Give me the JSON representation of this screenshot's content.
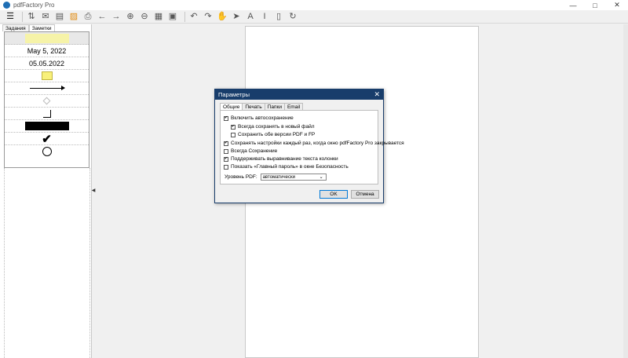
{
  "window": {
    "title": "pdfFactory Pro"
  },
  "toolbar": {
    "icons": [
      "menu-icon",
      "clip-icon",
      "email-icon",
      "save-icon",
      "open-folder-icon",
      "print-icon",
      "back-arrow-icon",
      "forward-arrow-icon",
      "zoom-in-icon",
      "zoom-out-icon",
      "grid-icon",
      "fit-page-icon",
      "undo-icon",
      "redo-icon",
      "hand-tool-icon",
      "pointer-icon",
      "text-tool-icon",
      "text-select-icon",
      "columns-icon",
      "refresh-icon"
    ]
  },
  "left_panel": {
    "tabs": [
      "Задания",
      "Заметки"
    ],
    "date_long": "May 5, 2022",
    "date_short": "05.05.2022"
  },
  "dialog": {
    "title": "Параметры",
    "tabs": [
      "Общие",
      "Печать",
      "Папки",
      "Email"
    ],
    "options": [
      {
        "label": "Включить автосохранение",
        "checked": true
      },
      {
        "label": "Всегда сохранять в новый файл",
        "checked": true
      },
      {
        "label": "Сохранить обе версии PDF и FP",
        "checked": false
      },
      {
        "label": "Сохранять настройки каждый раз, когда окно pdfFactory Pro закрывается",
        "checked": true
      },
      {
        "label": "Всегда Сохранение",
        "checked": false
      },
      {
        "label": "Поддерживать выравнивание текста колонки",
        "checked": true
      },
      {
        "label": "Показать «Главный пароль» в окне Безопасность",
        "checked": false
      }
    ],
    "pdf_level_label": "Уровень PDF:",
    "pdf_level_value": "автоматически",
    "ok": "OK",
    "cancel": "Отмена"
  },
  "colors": {
    "dialog_title_bg": "#183d6b",
    "ok_border": "#0078d7"
  }
}
